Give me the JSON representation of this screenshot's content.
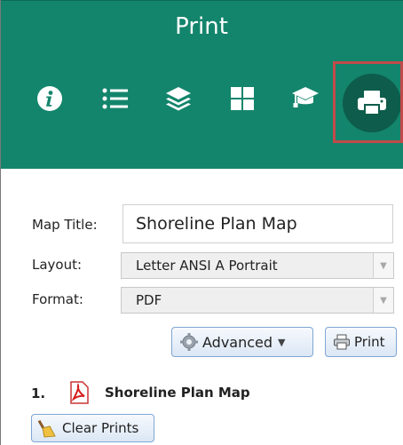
{
  "header": {
    "title": "Print",
    "icons": [
      "info-icon",
      "list-icon",
      "layers-icon",
      "basemap-grid-icon",
      "education-icon",
      "print-icon"
    ],
    "colors": {
      "background": "#13856c",
      "active_circle": "#0e5c4b",
      "highlight_border": "#c24a4a"
    }
  },
  "form": {
    "map_title_label": "Map Title:",
    "map_title_value": "Shoreline Plan Map",
    "layout_label": "Layout:",
    "layout_value": "Letter ANSI A Portrait",
    "format_label": "Format:",
    "format_value": "PDF"
  },
  "buttons": {
    "advanced_label": "Advanced",
    "print_label": "Print",
    "clear_label": "Clear Prints"
  },
  "results": [
    {
      "number": "1.",
      "name": "Shoreline Plan Map",
      "icon": "pdf-icon"
    }
  ]
}
